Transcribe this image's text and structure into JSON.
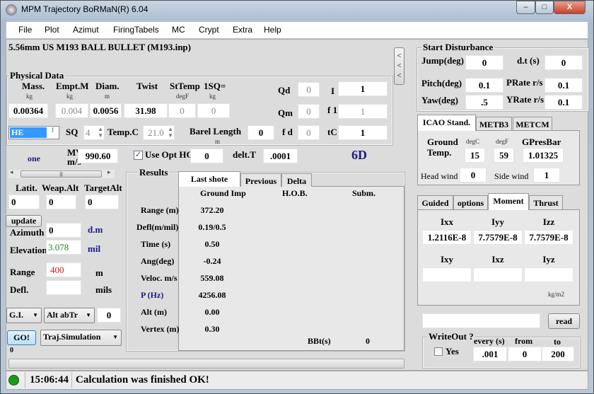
{
  "window": {
    "title": "MPM Trajectory BoRMaN(R) 6.04",
    "minimize": "–",
    "maximize": "□",
    "close": "X"
  },
  "menu": [
    "File",
    "Plot",
    "Azimut",
    "FiringTabels",
    "MC",
    "Crypt",
    "Extra",
    "Help"
  ],
  "projectile": "5.56mm US M193 BALL BULLET (M193.inp)",
  "collapse": "< < <",
  "physical": {
    "title": "Physical Data",
    "cols": [
      {
        "label": "Mass.",
        "unit": "kg",
        "value": "0.00364"
      },
      {
        "label": "Empt.M",
        "unit": "kg",
        "value": "0.004"
      },
      {
        "label": "Diam.",
        "unit": "m",
        "value": "0.0056"
      },
      {
        "label": "Twist",
        "unit": "",
        "value": "31.98"
      },
      {
        "label": "StTemp",
        "unit": "degF",
        "value": "0"
      },
      {
        "label": "1SQ=",
        "unit": "kg",
        "value": "0"
      }
    ],
    "qd": {
      "label": "Qd",
      "value": "0"
    },
    "qm": {
      "label": "Qm",
      "value": "0"
    },
    "fd": {
      "label": "f d",
      "value": "0"
    },
    "i": {
      "label": "I",
      "value": "1"
    },
    "f1": {
      "label": "f 1",
      "value": "1"
    },
    "tc": {
      "label": "tC",
      "value": "1"
    },
    "type_select": "HE",
    "sq": {
      "label": "SQ",
      "value": "4"
    },
    "temp": {
      "label": "Temp.C",
      "value": "21.0"
    },
    "barrel": {
      "label": "Barel Length",
      "unit": "m",
      "value": "0"
    }
  },
  "mv": {
    "mode": "one",
    "label": "MV",
    "unit": "m/s",
    "value": "990.60",
    "use_opt_hob": {
      "label": "Use Opt HOB",
      "checked": true,
      "value": "0"
    },
    "deltT": {
      "label": "delt.T",
      "value": ".0001"
    },
    "dof": "6D"
  },
  "position": {
    "latit": {
      "label": "Latit.",
      "value": "0"
    },
    "weapalt": {
      "label": "Weap.Alt",
      "value": "0"
    },
    "targetalt": {
      "label": "TargetAlt",
      "value": "0"
    }
  },
  "update": "update",
  "aim": {
    "azimuth": {
      "label": "Azimuth",
      "value": "0",
      "unit": "d.m"
    },
    "elevation": {
      "label": "Elevation",
      "value": "3.078",
      "unit": "mil"
    },
    "range": {
      "label": "Range",
      "value": "400",
      "unit": "m"
    },
    "defl": {
      "label": "Defl.",
      "value": "",
      "unit": "mils"
    }
  },
  "controls": {
    "gi": "G.I.",
    "alt": "Alt abTr",
    "alt_value": "0",
    "go": "GO!",
    "sim": "Traj.Simulation",
    "counter": "0"
  },
  "results": {
    "title": "Results",
    "tabs": [
      "Last shote",
      "Previous",
      "Delta"
    ],
    "active_tab": 0,
    "headers": [
      "Ground Imp",
      "H.O.B.",
      "Subm."
    ],
    "rows": [
      {
        "label": "Range (m)",
        "value": "372.20"
      },
      {
        "label": "Defl(m/mil)",
        "value": "0.19/0.5"
      },
      {
        "label": "Time (s)",
        "value": "0.50"
      },
      {
        "label": "Ang(deg)",
        "value": "-0.24"
      },
      {
        "label": "Veloc. m/s",
        "value": "559.08"
      },
      {
        "label": "P (Hz)",
        "value": "4256.08"
      },
      {
        "label": "Alt (m)",
        "value": "0.00"
      },
      {
        "label": "Vertex (m)",
        "value": "0.30"
      }
    ],
    "bbt": {
      "label": "BBt(s)",
      "value": "0"
    }
  },
  "disturbance": {
    "title": "Start Disturbance",
    "jump": {
      "label": "Jump(deg)",
      "value": "0"
    },
    "dt": {
      "label": "d.t (s)",
      "value": "0"
    },
    "pitch": {
      "label": "Pitch(deg)",
      "value": "0.1"
    },
    "prate": {
      "label": "PRate r/s",
      "value": "0.1"
    },
    "yaw": {
      "label": "Yaw(deg)",
      "value": ".5"
    },
    "yrate": {
      "label": "YRate r/s",
      "value": "0.1"
    }
  },
  "atmo": {
    "tabs": [
      "ICAO Stand.",
      "METB3",
      "METCM"
    ],
    "active_tab": 0,
    "ground": "Ground",
    "temp": "Temp.",
    "degc_label": "degC",
    "degf_label": "degF",
    "degc": "15",
    "degf": "59",
    "gpres_label": "GPresBar",
    "gpres": "1.01325",
    "headwind": {
      "label": "Head wind",
      "value": "0"
    },
    "sidewind": {
      "label": "Side wind",
      "value": "1"
    }
  },
  "moment": {
    "tabs": [
      "Guided",
      "options",
      "Moment",
      "Thrust"
    ],
    "active_tab": 2,
    "labels": [
      "Ixx",
      "Iyy",
      "Izz",
      "Ixy",
      "Ixz",
      "Iyz"
    ],
    "values": [
      "1.2116E-8",
      "7.7579E-8",
      "7.7579E-8",
      "",
      "",
      ""
    ],
    "unit": "kg/m2"
  },
  "file": {
    "value": "",
    "read": "read"
  },
  "writeout": {
    "title": "WriteOut ?",
    "yes": "Yes",
    "checked": false,
    "every_label": "every (s)",
    "from_label": "from",
    "to_label": "to",
    "every": ".001",
    "from": "0",
    "to": "200"
  },
  "status": {
    "time": "15:06:44",
    "message": "Calculation was finished OK!",
    "indicator_color": "#1a9a1a"
  },
  "colors": {
    "elevation": "#1f8a1f",
    "range": "#cc2020",
    "blue_label": "#1a1a8a"
  }
}
